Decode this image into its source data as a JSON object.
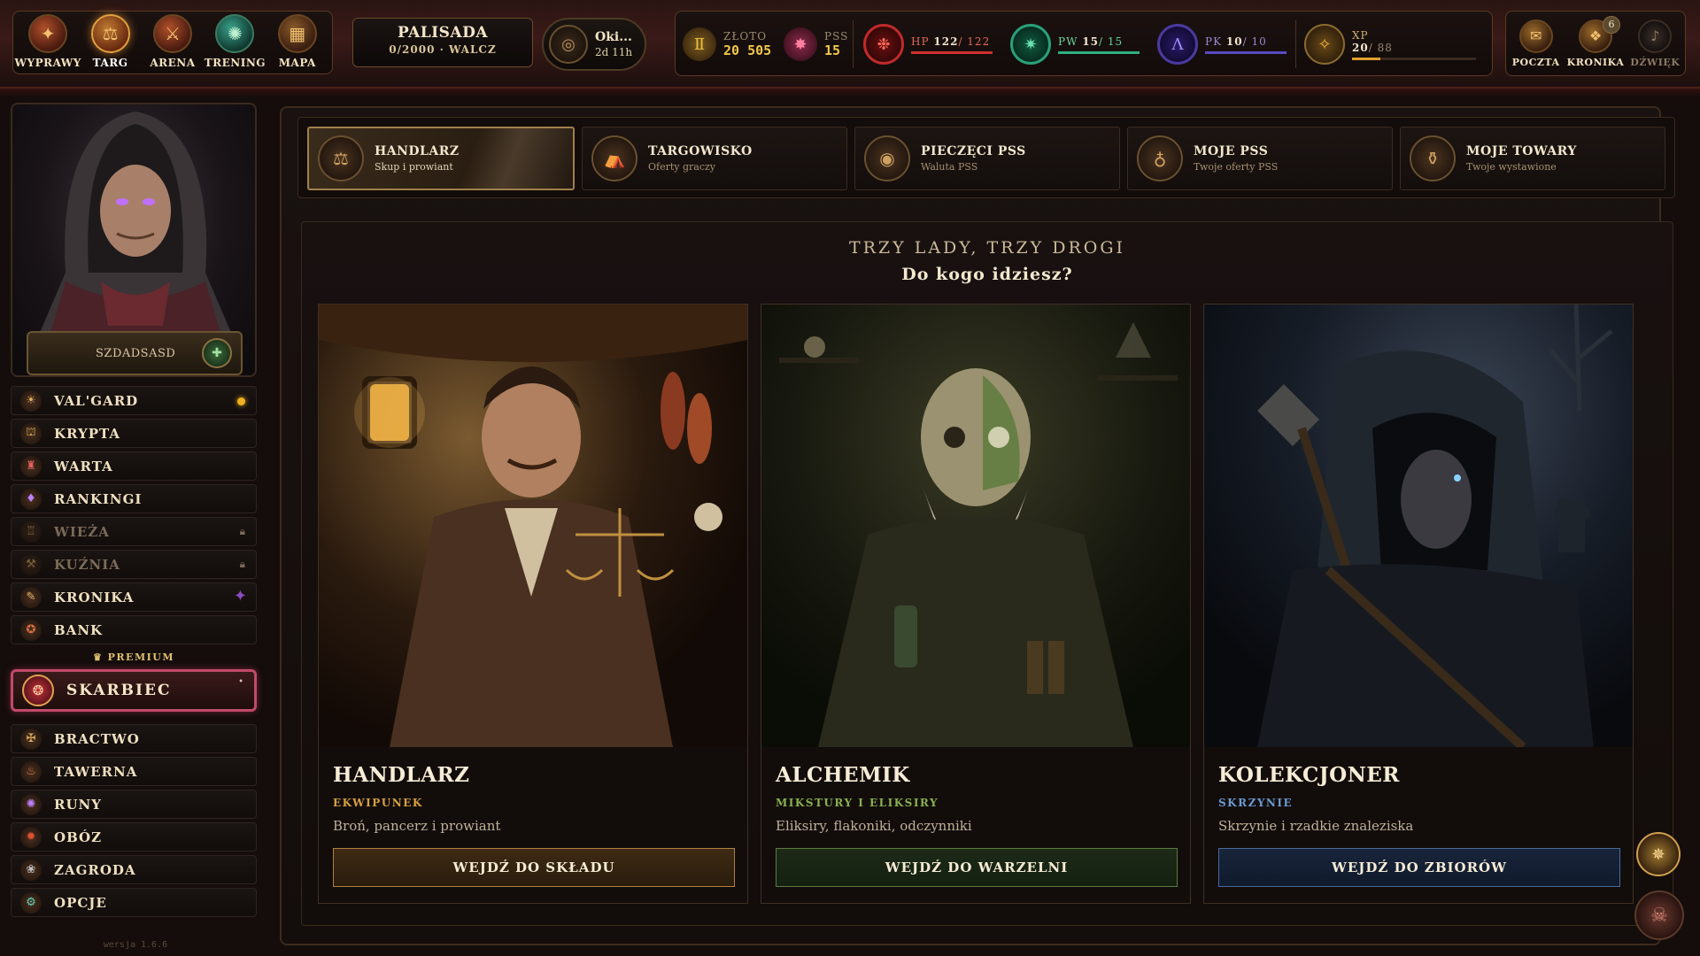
{
  "topnav": {
    "items": [
      {
        "label": "WYPRAWY",
        "icon": "compass-icon"
      },
      {
        "label": "TARG",
        "icon": "market-icon",
        "active": true
      },
      {
        "label": "ARENA",
        "icon": "arena-icon"
      },
      {
        "label": "TRENING",
        "icon": "training-icon"
      },
      {
        "label": "MAPA",
        "icon": "map-icon"
      }
    ]
  },
  "palisada": {
    "title": "PALISADA",
    "status": "0/2000 · WALCZ"
  },
  "event": {
    "title": "Oki...",
    "time": "2d 11h"
  },
  "stats": {
    "gold": {
      "label": "ZŁOTO",
      "value": "20 505"
    },
    "pss": {
      "label": "PSS",
      "value": "15"
    },
    "hp": {
      "label": "HP",
      "current": "122",
      "max": "122",
      "fill": 1.0
    },
    "pw": {
      "label": "PW",
      "current": "15",
      "max": "15",
      "fill": 1.0
    },
    "pk": {
      "label": "PK",
      "current": "10",
      "max": "10",
      "fill": 1.0
    },
    "xp": {
      "label": "XP",
      "current": "20",
      "max": "88",
      "fill": 0.23
    }
  },
  "right_nav": {
    "poczta": {
      "label": "POCZTA",
      "badge": ""
    },
    "kronika": {
      "label": "KRONIKA",
      "badge": "6"
    },
    "dzwiek": {
      "label": "DŹWIĘK"
    }
  },
  "player": {
    "name": "SZDADSASD"
  },
  "sidebar": {
    "items": [
      {
        "label": "VAL'GARD",
        "state": "notify"
      },
      {
        "label": "KRYPTA"
      },
      {
        "label": "WARTA"
      },
      {
        "label": "RANKINGI"
      },
      {
        "label": "WIEŻA",
        "state": "locked"
      },
      {
        "label": "KUŹNIA",
        "state": "locked"
      },
      {
        "label": "KRONIKA",
        "state": "raven"
      },
      {
        "label": "BANK"
      }
    ],
    "premium_label": "♛ PREMIUM",
    "premium_item": "SKARBIEC",
    "items2": [
      {
        "label": "BRACTWO"
      },
      {
        "label": "TAWERNA"
      },
      {
        "label": "RUNY"
      },
      {
        "label": "OBÓZ"
      },
      {
        "label": "ZAGRODA"
      },
      {
        "label": "OPCJE"
      }
    ],
    "version": "wersja 1.6.6"
  },
  "tabs": [
    {
      "title": "HANDLARZ",
      "subtitle": "Skup i prowiant",
      "active": true
    },
    {
      "title": "TARGOWISKO",
      "subtitle": "Oferty graczy"
    },
    {
      "title": "PIECZĘCI PSS",
      "subtitle": "Waluta PSS"
    },
    {
      "title": "MOJE PSS",
      "subtitle": "Twoje oferty PSS"
    },
    {
      "title": "MOJE TOWARY",
      "subtitle": "Twoje wystawione"
    }
  ],
  "panel": {
    "heading": "TRZY LADY, TRZY DROGI",
    "subheading": "Do kogo idziesz?"
  },
  "cards": [
    {
      "name": "HANDLARZ",
      "category": "EKWIPUNEK",
      "category_color": "#d8a040",
      "desc": "Broń, pancerz i prowiant",
      "button": "WEJDŹ DO SKŁADU"
    },
    {
      "name": "ALCHEMIK",
      "category": "MIKSTURY I ELIKSIRY",
      "category_color": "#8ab050",
      "desc": "Eliksiry, flakoniki, odczynniki",
      "button": "WEJDŹ DO WARZELNI"
    },
    {
      "name": "KOLEKCJONER",
      "category": "SKRZYNIE",
      "category_color": "#6a9ad0",
      "desc": "Skrzynie i rzadkie znaleziska",
      "button": "WEJDŹ DO ZBIORÓW"
    }
  ]
}
